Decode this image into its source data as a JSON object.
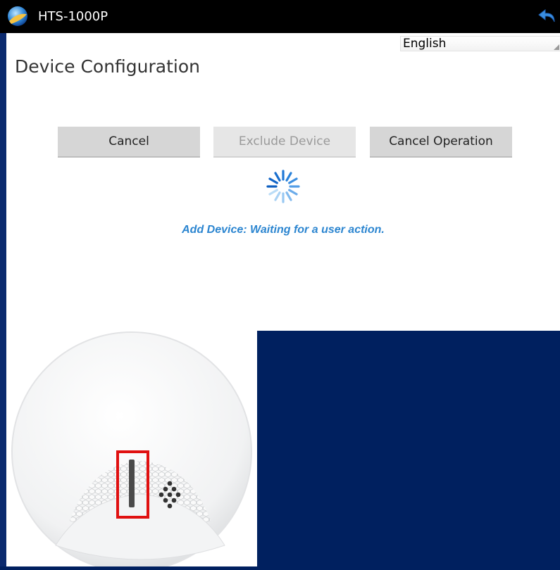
{
  "app": {
    "title": "HTS-1000P"
  },
  "language": {
    "selected": "English"
  },
  "page": {
    "title": "Device Configuration"
  },
  "buttons": {
    "cancel": "Cancel",
    "exclude": "Exclude Device",
    "cancel_operation": "Cancel Operation"
  },
  "status": {
    "text": "Add Device: Waiting for a user action."
  },
  "icons": {
    "app": "globe-icon",
    "back": "back-arrow-icon",
    "spinner": "loading-spinner-icon"
  },
  "colors": {
    "accent": "#2b85d0",
    "background": "#00205f",
    "highlight_box": "#e01010"
  }
}
